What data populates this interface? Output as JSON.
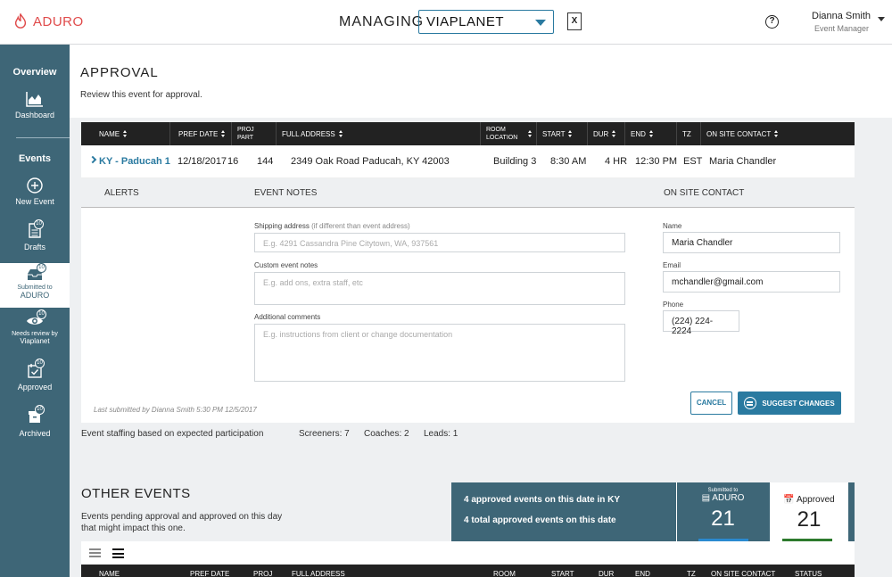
{
  "header": {
    "logo_text": "ADURO",
    "managing_label": "MANAGING",
    "org_selected": "VIAPLANET",
    "user_name": "Dianna Smith",
    "user_role": "Event Manager",
    "excel_icon": "X"
  },
  "sidebar": {
    "overview_label": "Overview",
    "dashboard_label": "Dashboard",
    "events_label": "Events",
    "new_event_label": "New Event",
    "drafts_label": "Drafts",
    "drafts_count": "10",
    "submitted_line1": "Submitted to",
    "submitted_line2": "ADURO",
    "submitted_count": "10",
    "needs_review_line1": "Needs review by",
    "needs_review_line2": "Viaplanet",
    "needs_review_count": "10",
    "approved_label": "Approved",
    "approved_count": "10",
    "archived_label": "Archived",
    "archived_count": "10"
  },
  "page": {
    "title": "APPROVAL",
    "subtitle": "Review this event for approval."
  },
  "table": {
    "headers": {
      "name": "NAME",
      "pref_date": "PREF DATE",
      "proj_part_1": "PROJ",
      "proj_part_2": "PART",
      "full_address": "FULL ADDRESS",
      "room_1": "ROOM",
      "room_2": "LOCATION",
      "start": "START",
      "dur": "DUR",
      "end": "END",
      "tz": "TZ",
      "contact": "ON SITE CONTACT"
    },
    "row": {
      "name": "KY - Paducah 1",
      "pref_date": "12/18/2017 16",
      "proj_part": "144",
      "address": "2349 Oak Road Paducah, KY 42003",
      "room": "Building 3",
      "start": "8:30 AM",
      "dur": "4 HR",
      "end": "12:30 PM",
      "tz": "EST",
      "contact": "Maria Chandler"
    }
  },
  "detail": {
    "alerts_head": "ALERTS",
    "notes_head": "EVENT NOTES",
    "contact_head": "ON SITE CONTACT",
    "shipping_label": "Shipping address",
    "shipping_hint": "(if different than event address)",
    "shipping_placeholder": "E.g. 4291 Cassandra Pine Citytown, WA, 937561",
    "custom_label": "Custom event notes",
    "custom_placeholder": "E.g. add ons, extra staff, etc",
    "comments_label": "Additional comments",
    "comments_placeholder": "E.g. instructions from client or change documentation",
    "name_label": "Name",
    "name_value": "Maria Chandler",
    "email_label": "Email",
    "email_value": "mchandler@gmail.com",
    "phone_label": "Phone",
    "phone_value": "(224) 224-2224",
    "last_submitted": "Last submitted by Dianna Smith 5:30 PM 12/5/2017",
    "cancel_label": "CANCEL",
    "suggest_label": "SUGGEST CHANGES"
  },
  "staffing": {
    "label": "Event staffing based on expected participation",
    "screeners": "Screeners: 7",
    "coaches": "Coaches: 2",
    "leads": "Leads: 1"
  },
  "other_events": {
    "title": "OTHER EVENTS",
    "subtitle": "Events pending approval and approved on this day that might impact this one.",
    "stat_line_1": "4 approved events on this date in KY",
    "stat_line_2": "4 total approved events on this date",
    "submitted_small": "Submitted to",
    "submitted_label": "ADURO",
    "submitted_count": "21",
    "approved_label": "Approved",
    "approved_count": "21",
    "headers": {
      "name": "NAME",
      "pref_date": "PREF DATE",
      "proj": "PROJ",
      "full_address": "FULL ADDRESS",
      "room": "ROOM",
      "start": "START",
      "dur": "DUR",
      "end": "END",
      "tz": "TZ",
      "contact": "ON SITE CONTACT",
      "status": "STATUS"
    }
  },
  "colors": {
    "sidebar": "#3e6677",
    "accent": "#2a7aa0",
    "logo": "#e04b4b",
    "approved_bar": "#2d7a2d",
    "submitted_bar": "#2a8ad0"
  }
}
